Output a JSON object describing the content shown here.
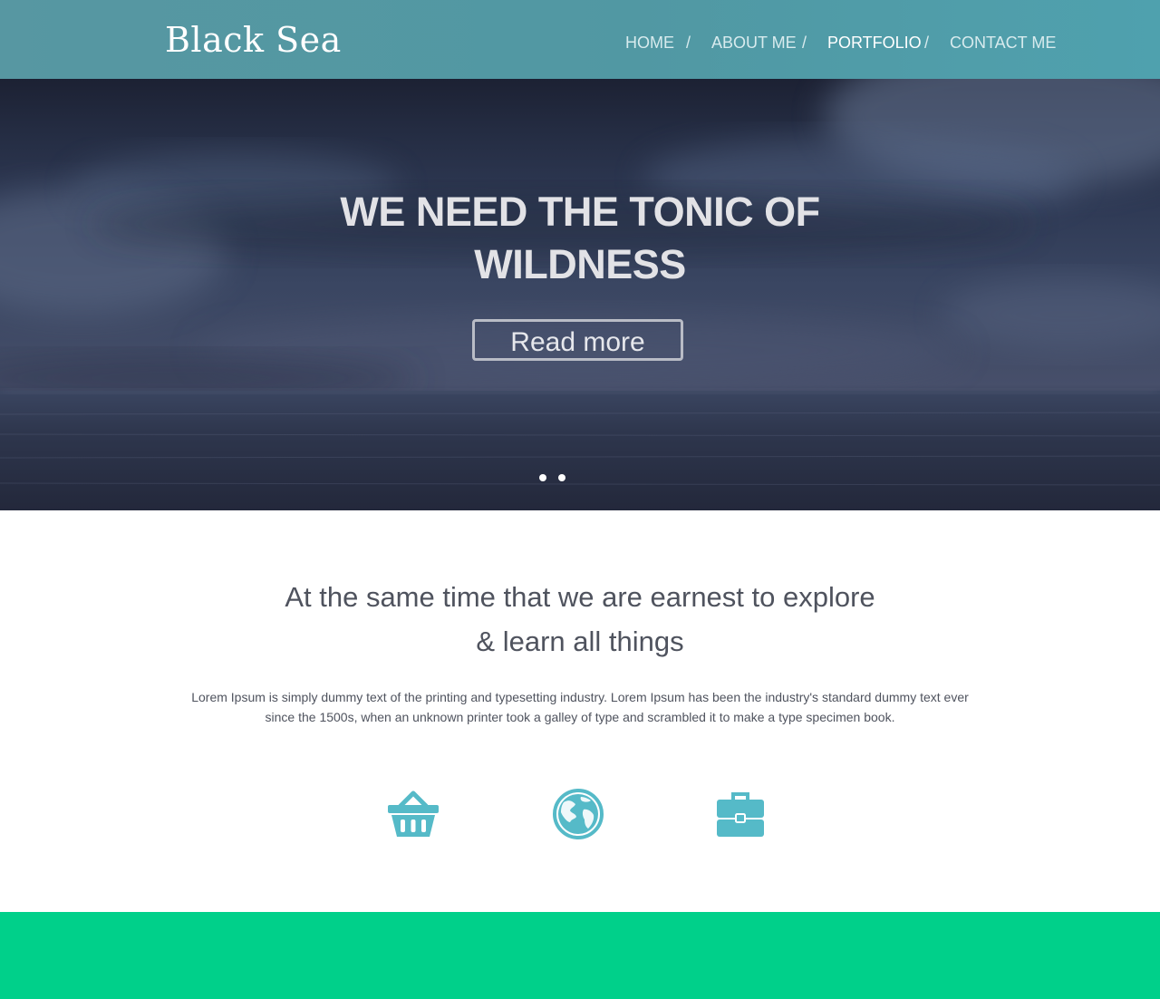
{
  "header": {
    "logo": "Black Sea",
    "nav": [
      {
        "label": "HOME",
        "active": false
      },
      {
        "label": "ABOUT ME",
        "active": false
      },
      {
        "label": "PORTFOLIO",
        "active": true
      },
      {
        "label": "CONTACT ME",
        "active": false
      }
    ],
    "separator": "/"
  },
  "hero": {
    "title": "WE NEED THE TONIC OF WILDNESS",
    "cta_label": "Read more",
    "slides_count": 2
  },
  "intro": {
    "heading_line1": "At the same time that we are earnest to explore",
    "heading_line2": "& learn all things",
    "body": "Lorem Ipsum is simply dummy text of the printing and typesetting industry. Lorem Ipsum has been the industry's standard dummy text ever since the 1500s, when an unknown printer took a galley of type and scrambled it to make a type specimen book."
  },
  "features": {
    "icons": [
      "basket-icon",
      "globe-icon",
      "briefcase-icon"
    ]
  },
  "colors": {
    "header_bg": "#5198a3",
    "accent": "#55bac8",
    "text_dark": "#4f535e",
    "band_green": "#00d08a",
    "hero_bg": "#2f3a55"
  }
}
